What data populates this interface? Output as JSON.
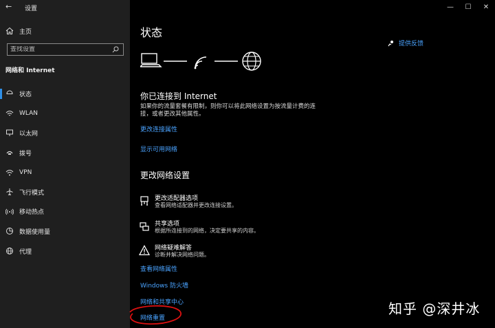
{
  "window": {
    "title": "设置"
  },
  "sidebar": {
    "home_label": "主页",
    "search_placeholder": "查找设置",
    "section_heading": "网络和 Internet",
    "items": [
      {
        "label": "状态",
        "icon": "home-status-icon"
      },
      {
        "label": "WLAN",
        "icon": "wifi-icon"
      },
      {
        "label": "以太网",
        "icon": "ethernet-icon"
      },
      {
        "label": "拨号",
        "icon": "dialup-icon"
      },
      {
        "label": "VPN",
        "icon": "vpn-icon"
      },
      {
        "label": "飞行模式",
        "icon": "airplane-icon"
      },
      {
        "label": "移动热点",
        "icon": "hotspot-icon"
      },
      {
        "label": "数据使用量",
        "icon": "data-usage-icon"
      },
      {
        "label": "代理",
        "icon": "globe-icon"
      }
    ]
  },
  "main": {
    "title": "状态",
    "feedback": "提供反馈",
    "connected_title": "你已连接到 Internet",
    "connected_desc": "如果你的流量套餐有限制，则你可以将此网络设置为按流量计费的连接，或者更改其他属性。",
    "links1": [
      "更改连接属性",
      "显示可用网络"
    ],
    "section_title": "更改网络设置",
    "options": [
      {
        "title": "更改适配器选项",
        "subtitle": "查看网络适配器并更改连接设置。"
      },
      {
        "title": "共享选项",
        "subtitle": "根据所连接到的网络，决定要共享的内容。"
      },
      {
        "title": "网络疑难解答",
        "subtitle": "诊断并解决网络问题。"
      }
    ],
    "links2": [
      "查看网络属性",
      "Windows 防火墙",
      "网络和共享中心",
      "网络重置"
    ]
  },
  "watermark": "知乎 @深井冰"
}
